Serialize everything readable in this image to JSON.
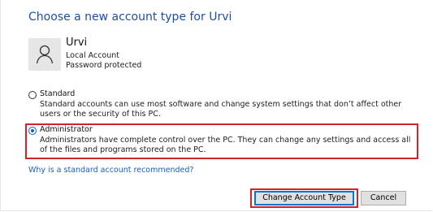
{
  "dialog": {
    "title": "Choose a new account type for Urvi"
  },
  "account": {
    "avatar_icon": "user-icon",
    "name": "Urvi",
    "type": "Local Account",
    "status": "Password protected"
  },
  "options": {
    "standard": {
      "label": "Standard",
      "selected": false,
      "description": "Standard accounts can use most software and change system settings that don’t affect other users or the security of this PC."
    },
    "administrator": {
      "label": "Administrator",
      "selected": true,
      "description": "Administrators have complete control over the PC. They can change any settings and access all of the files and programs stored on the PC."
    }
  },
  "help_link": "Why is a standard account recommended?",
  "buttons": {
    "primary": "Change Account Type",
    "cancel": "Cancel"
  },
  "colors": {
    "title": "#1e4e9c",
    "link": "#1a5fb4",
    "highlight": "#d2232a",
    "accent": "#0078d7"
  }
}
